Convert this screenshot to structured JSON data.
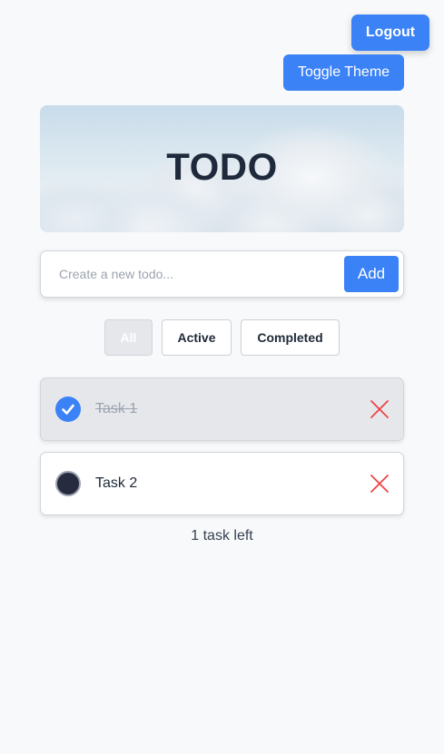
{
  "header": {
    "logout_label": "Logout",
    "toggle_theme_label": "Toggle Theme"
  },
  "hero": {
    "title": "TODO"
  },
  "new_todo": {
    "placeholder": "Create a new todo...",
    "value": "",
    "add_label": "Add"
  },
  "filters": {
    "all": "All",
    "active": "Active",
    "completed": "Completed",
    "selected": "All"
  },
  "tasks": [
    {
      "title": "Task 1",
      "completed": true
    },
    {
      "title": "Task 2",
      "completed": false
    }
  ],
  "footer": {
    "tasks_left": "1 task left"
  },
  "colors": {
    "accent": "#3b82f6",
    "delete": "#ef4444",
    "completed_card": "#e5e7eb"
  },
  "icons": {
    "check": "check-icon",
    "delete": "close-icon"
  }
}
